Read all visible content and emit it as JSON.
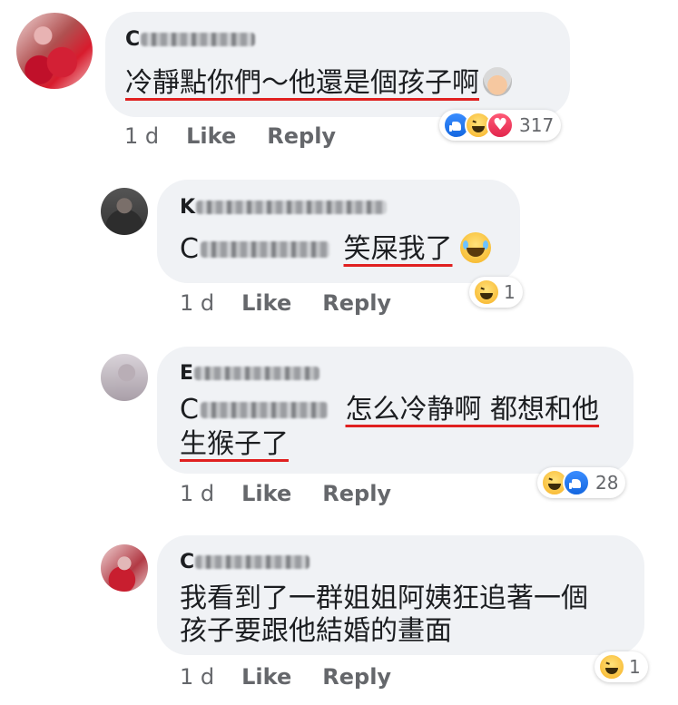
{
  "comments": [
    {
      "author_initial": "C",
      "text_parts": [
        "冷靜點你們～他還是個孩子啊"
      ],
      "emoji": "older-woman-emoji",
      "time": "1 d",
      "like_label": "Like",
      "reply_label": "Reply",
      "reaction_count": "317",
      "reactions": [
        "like",
        "haha",
        "love"
      ]
    },
    {
      "author_initial": "K",
      "mention_initial": "C",
      "text": "笑屎我了",
      "emoji": "tears-of-joy-emoji",
      "time": "1 d",
      "like_label": "Like",
      "reply_label": "Reply",
      "reaction_count": "1",
      "reactions": [
        "haha"
      ]
    },
    {
      "author_initial": "E",
      "mention_initial": "C",
      "text_line1": "怎么冷静啊 都想和他",
      "text_line2": "生猴子了",
      "time": "1 d",
      "like_label": "Like",
      "reply_label": "Reply",
      "reaction_count": "28",
      "reactions": [
        "haha",
        "like"
      ]
    },
    {
      "author_initial": "C",
      "text_line1": "我看到了一群姐姐阿姨狂追著一個",
      "text_line2": "孩子要跟他結婚的畫面",
      "time": "1 d",
      "like_label": "Like",
      "reply_label": "Reply",
      "reaction_count": "1",
      "reactions": [
        "haha"
      ]
    }
  ],
  "colors": {
    "bubble": "#f0f2f5",
    "meta_text": "#65676b",
    "body_text": "#1c1e21",
    "underline_annotation": "#e02020",
    "like_blue": "#1877f2",
    "love_red": "#e2264d",
    "haha_yellow": "#f7b125"
  }
}
